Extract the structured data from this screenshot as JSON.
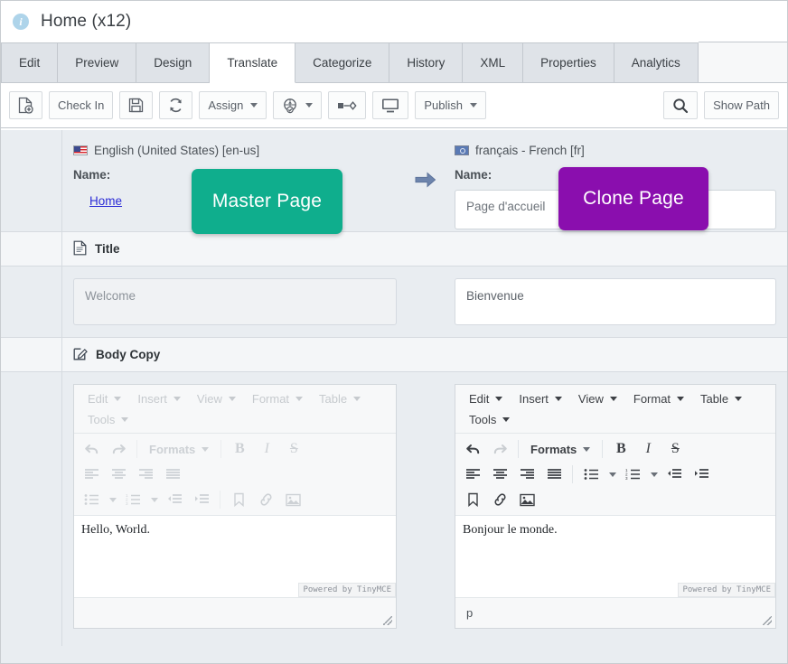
{
  "window": {
    "title": "Home (x12)",
    "info_icon": "info-icon"
  },
  "tabs": [
    {
      "label": "Edit",
      "active": false
    },
    {
      "label": "Preview",
      "active": false
    },
    {
      "label": "Design",
      "active": false
    },
    {
      "label": "Translate",
      "active": true
    },
    {
      "label": "Categorize",
      "active": false
    },
    {
      "label": "History",
      "active": false
    },
    {
      "label": "XML",
      "active": false
    },
    {
      "label": "Properties",
      "active": false
    },
    {
      "label": "Analytics",
      "active": false
    }
  ],
  "toolbar": {
    "new_page": {
      "icon": "new-page-icon",
      "label": ""
    },
    "check_in": {
      "label": "Check In"
    },
    "save": {
      "icon": "save-disk-icon"
    },
    "refresh": {
      "icon": "refresh-icon"
    },
    "assign": {
      "label": "Assign",
      "caret": true
    },
    "workflow": {
      "icon": "workflow-icon",
      "caret": true
    },
    "relate": {
      "icon": "relate-icon"
    },
    "preview_screen": {
      "icon": "monitor-icon"
    },
    "publish": {
      "label": "Publish",
      "caret": true
    },
    "search": {
      "icon": "search-icon"
    },
    "show_path": {
      "label": "Show Path"
    }
  },
  "callouts": {
    "master": {
      "label": "Master Page",
      "color": "#0fae8d"
    },
    "clone": {
      "label": "Clone Page",
      "color": "#8a0eae"
    }
  },
  "languages": {
    "source": {
      "flag": "flag-us-icon",
      "label": "English (United States) [en-us]",
      "name_label": "Name:",
      "name_value": "Home",
      "name_is_link": true
    },
    "arrow_icon": "arrow-right-icon",
    "target": {
      "flag": "flag-un-icon",
      "label": "français - French [fr]",
      "name_label": "Name:",
      "name_value": "Page d'accueil",
      "name_is_link": false
    }
  },
  "sections": [
    {
      "icon": "document-icon",
      "title": "Title",
      "source_value": "Welcome",
      "target_value": "Bienvenue"
    },
    {
      "icon": "edit-pencil-icon",
      "title": "Body Copy",
      "source_value": "Hello, World.",
      "target_value": "Bonjour le monde."
    }
  ],
  "editor": {
    "menus": [
      "Edit",
      "Insert",
      "View",
      "Format",
      "Table",
      "Tools"
    ],
    "formats_label": "Formats",
    "brand": "Powered by TinyMCE",
    "source_statusbar_path": "",
    "target_statusbar_path": "p",
    "tools": [
      "undo-icon",
      "redo-icon",
      "formats-dropdown",
      "bold-icon",
      "italic-icon",
      "strikethrough-icon",
      "align-left-icon",
      "align-center-icon",
      "align-right-icon",
      "align-justify-icon",
      "bullet-list-icon",
      "numbered-list-icon",
      "outdent-icon",
      "indent-icon",
      "bookmark-icon",
      "link-icon",
      "image-icon"
    ]
  }
}
